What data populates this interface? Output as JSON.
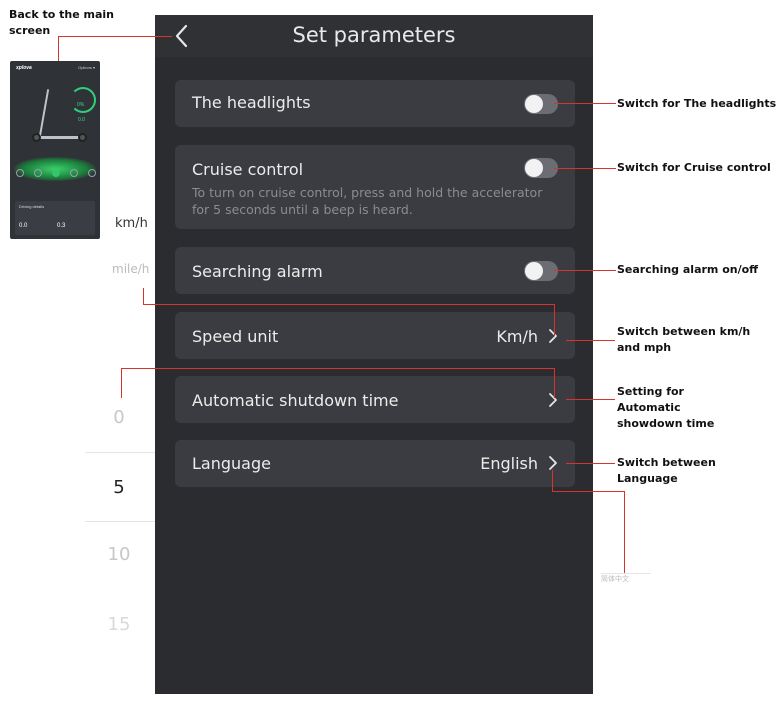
{
  "annotations": {
    "back": "Back to the main screen",
    "headlights": "Switch for The headlights",
    "cruise": "Switch for Cruise control",
    "alarm": "Searching alarm on/off",
    "speed_unit": "Switch between km/h and mph",
    "shutdown": "Setting for Automatic showdown time",
    "language": "Switch between Language"
  },
  "thumbnail": {
    "brand": "xplova",
    "menu": "Options ▾",
    "percent": "0%",
    "speed": "0.0",
    "card_title": "Driving details",
    "distance_1": "0.0",
    "distance_2": "0.3"
  },
  "unit_picker": {
    "options": [
      "km/h",
      "mile/h"
    ]
  },
  "time_picker": {
    "options": [
      "0",
      "5",
      "10",
      "15"
    ],
    "selected": "5"
  },
  "language_picker_ghost": "简体中文",
  "screen": {
    "title": "Set parameters",
    "rows": [
      {
        "label": "The headlights",
        "type": "toggle",
        "state": "off"
      },
      {
        "label": "Cruise control",
        "type": "toggle",
        "state": "off",
        "description": "To turn on cruise control, press and hold the accelerator for 5 seconds until a beep is heard."
      },
      {
        "label": "Searching alarm",
        "type": "toggle",
        "state": "off"
      },
      {
        "label": "Speed unit",
        "type": "select",
        "value": "Km/h"
      },
      {
        "label": "Automatic shutdown time",
        "type": "select",
        "value": ""
      },
      {
        "label": "Language",
        "type": "select",
        "value": "English"
      }
    ]
  },
  "colors": {
    "screen_bg": "#2a2c30",
    "row_bg": "#3a3c41",
    "annotation_line": "#d9342b",
    "accent_green": "#36c46d"
  }
}
